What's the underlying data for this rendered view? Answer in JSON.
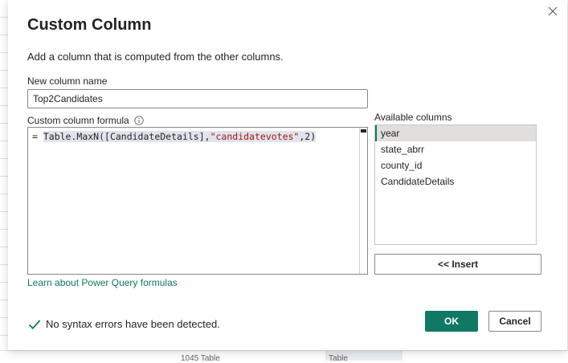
{
  "background": {
    "bottom_cell_text": "1045 Table",
    "bottom_col_text": "Table"
  },
  "dialog": {
    "title": "Custom Column",
    "subtitle": "Add a column that is computed from the other columns.",
    "close_icon": "close-icon"
  },
  "new_column": {
    "label": "New column name",
    "value": "Top2Candidates"
  },
  "formula": {
    "label": "Custom column formula",
    "info_icon": "info-icon",
    "prefix": "= ",
    "part1": "Table.MaxN([CandidateDetails],",
    "string": "\"candidatevotes\"",
    "part2": ",2)"
  },
  "available_columns": {
    "label": "Available columns",
    "items": [
      "year",
      "state_abrr",
      "county_id",
      "CandidateDetails"
    ],
    "selected_index": 0
  },
  "insert_button": {
    "label": "<< Insert"
  },
  "learn_link": {
    "label": "Learn about Power Query formulas"
  },
  "status": {
    "icon": "checkmark-icon",
    "text": "No syntax errors have been detected."
  },
  "buttons": {
    "ok_label": "OK",
    "cancel_label": "Cancel"
  },
  "colors": {
    "accent": "#117865",
    "string": "#a31515"
  }
}
